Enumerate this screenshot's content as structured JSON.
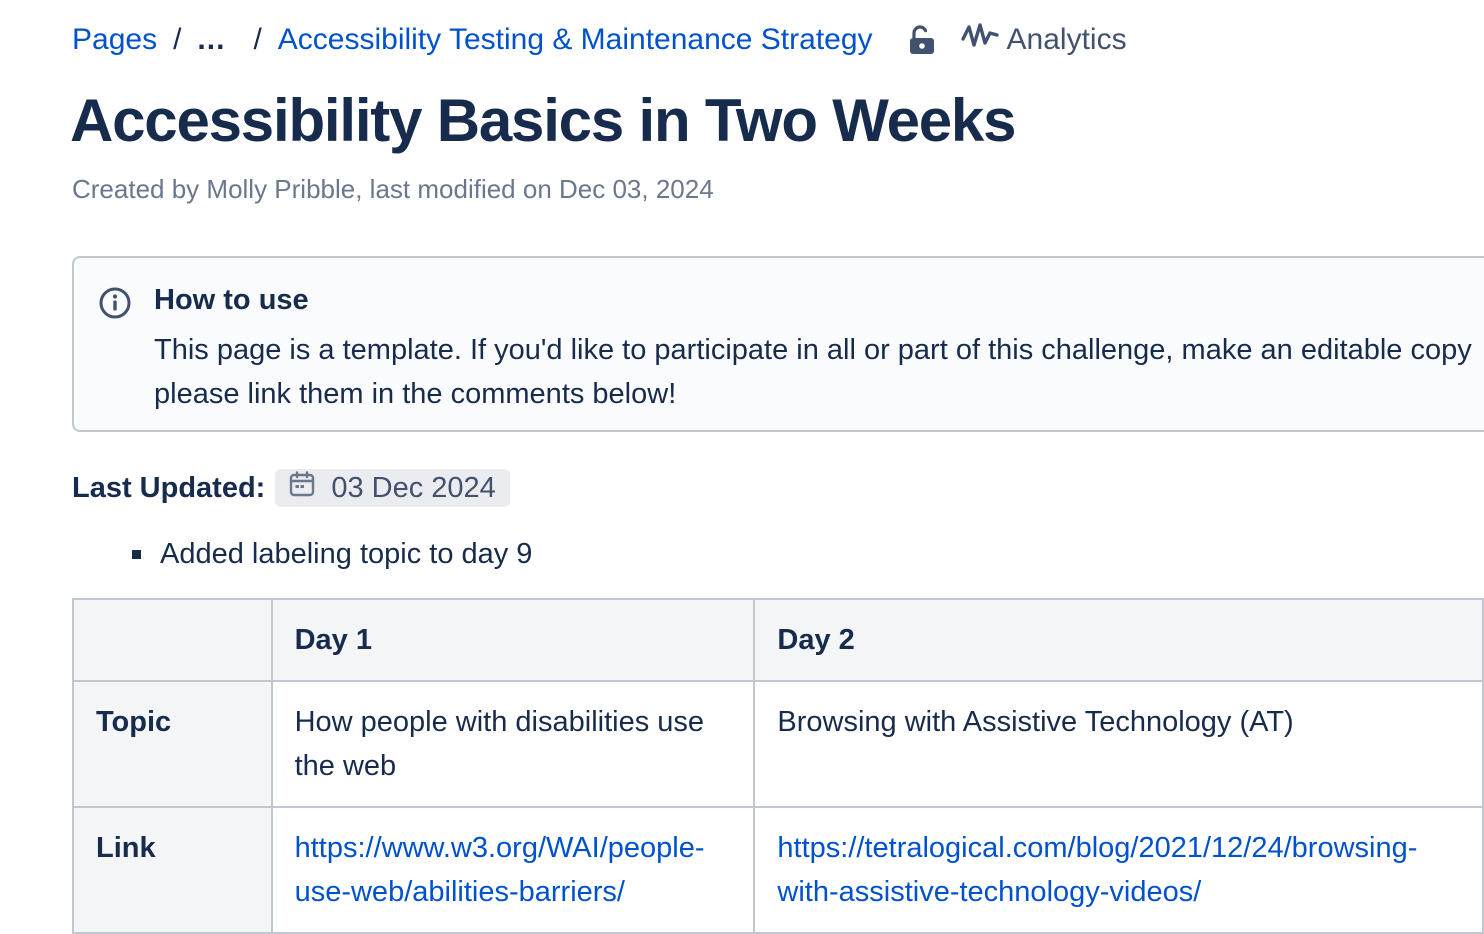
{
  "breadcrumb": {
    "root": "Pages",
    "separator": "/",
    "ellipsis": "...",
    "parent": "Accessibility Testing & Maintenance Strategy",
    "analytics_label": "Analytics"
  },
  "page": {
    "title": "Accessibility Basics in Two Weeks",
    "byline": "Created by Molly Pribble, last modified on Dec 03, 2024"
  },
  "info_panel": {
    "heading": "How to use",
    "line1": "This page is a template. If you'd like to participate in all or part of this challenge, make an editable copy",
    "line2": "please link them in the comments below!"
  },
  "last_updated": {
    "label": "Last Updated:",
    "date": "03 Dec 2024"
  },
  "changes": [
    "Added labeling topic to day 9"
  ],
  "table": {
    "headers": [
      "",
      "Day 1",
      "Day 2"
    ],
    "rows": [
      {
        "label": "Topic",
        "day1": "How people with disabilities use the web",
        "day2": "Browsing with Assistive Technology (AT)"
      },
      {
        "label": "Link",
        "day1": "https://www.w3.org/WAI/people-use-web/abilities-barriers/",
        "day2": "https://tetralogical.com/blog/2021/12/24/browsing-with-assistive-technology-videos/"
      }
    ]
  },
  "colors": {
    "link": "#0052cc",
    "text": "#172b4d",
    "muted": "#6b778c",
    "border": "#c1c7d0",
    "header_bg": "#f4f5f7"
  },
  "icons": [
    "unlock-icon",
    "analytics-icon",
    "info-icon",
    "calendar-icon"
  ]
}
